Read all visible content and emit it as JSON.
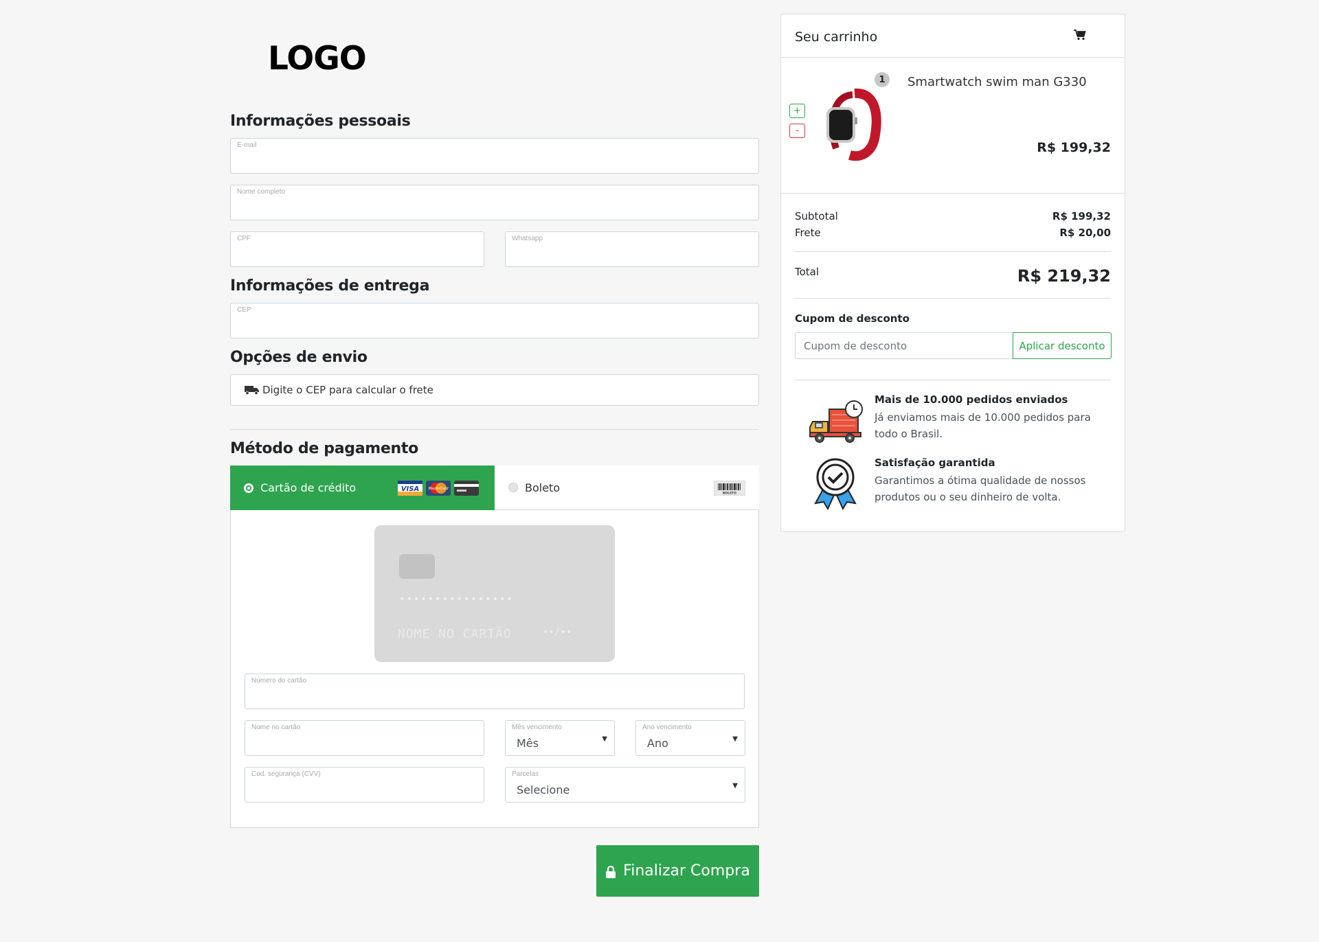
{
  "logo": "LOGO",
  "sections": {
    "personal": "Informações pessoais",
    "delivery": "Informações de entrega",
    "shipping": "Opções de envio",
    "payment": "Método de pagamento"
  },
  "fields": {
    "email": "E-mail",
    "name": "Nome completo",
    "cpf": "CPF",
    "whatsapp": "Whatsapp",
    "cep": "CEP"
  },
  "shipping": {
    "placeholder": "Digite o CEP para calcular o frete"
  },
  "payment": {
    "credit_card": "Cartão de crédito",
    "boleto": "Boleto",
    "selected": "credit_card",
    "card_brands": [
      "VISA",
      "MasterCard",
      "generic-card"
    ],
    "card_preview": {
      "number_mask": "••••••••••••••••",
      "name_placeholder": "NOME NO CARTÃO",
      "expiry_mask": "••/••"
    },
    "fields": {
      "card_number": "Número do cartão",
      "card_name": "Nome no cartão",
      "exp_month_label": "Mês vencimento",
      "exp_month_value": "Mês",
      "exp_year_label": "Ano vencimento",
      "exp_year_value": "Ano",
      "cvv": "Cod. segurança (CVV)",
      "installments_label": "Parcelas",
      "installments_value": "Selecione"
    }
  },
  "submit_label": "Finalizar Compra",
  "cart": {
    "title": "Seu carrinho",
    "item": {
      "name": "Smartwatch swim man G330",
      "price": "R$ 199,32",
      "qty": "1",
      "plus": "+",
      "minus": "-"
    },
    "subtotal_label": "Subtotal",
    "subtotal": "R$ 199,32",
    "shipping_label": "Frete",
    "shipping": "R$ 20,00",
    "total_label": "Total",
    "total": "R$ 219,32",
    "coupon_title": "Cupom de desconto",
    "coupon_placeholder": "Cupom de desconto",
    "coupon_button": "Aplicar desconto",
    "features": [
      {
        "title": "Mais de 10.000 pedidos enviados",
        "text": "Já enviamos mais de 10.000 pedidos para todo o Brasil."
      },
      {
        "title": "Satisfação garantida",
        "text": "Garantimos a ótima qualidade de nossos produtos ou o seu dinheiro de volta."
      }
    ]
  },
  "colors": {
    "accent": "#2ea44f",
    "danger": "#dc3545",
    "background": "#f6f6f6"
  }
}
